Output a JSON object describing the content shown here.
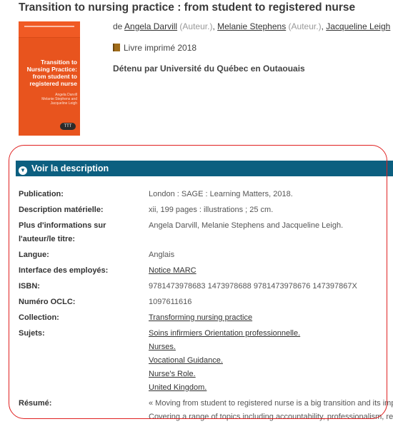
{
  "record": {
    "title": "Transition to nursing practice : from student to registered nurse",
    "by": "de",
    "authors": [
      {
        "name": "Angela Darvill",
        "role": "(Auteur.)"
      },
      {
        "name": "Melanie Stephens",
        "role": "(Auteur.)"
      },
      {
        "name": "Jacqueline Leigh",
        "role": ""
      }
    ],
    "format": "Livre imprimé 2018",
    "held_by": "Détenu par Université du Québec en Outaouais",
    "cover": {
      "title": "Transition to Nursing Practice: from student to registered nurse",
      "authors": [
        "Angela Darvill",
        "Melanie Stephens and",
        "Jacqueline Leigh"
      ],
      "badge": "TTT",
      "color": "#e8541e"
    }
  },
  "description": {
    "toggle_label": "Voir la description",
    "band_color": "#0c5f80",
    "fields": {
      "publication": {
        "label": "Publication:",
        "value": "London : SAGE : Learning Matters, 2018."
      },
      "physical": {
        "label": "Description matérielle:",
        "value": "xii, 199 pages : illustrations ; 25 cm."
      },
      "more_info": {
        "label_line1": "Plus d'informations sur",
        "label_line2": "l'auteur/le titre:",
        "value": "Angela Darvill, Melanie Stephens and Jacqueline Leigh."
      },
      "language": {
        "label": "Langue:",
        "value": "Anglais"
      },
      "staff": {
        "label": "Interface des employés:",
        "value": "Notice MARC"
      },
      "isbn": {
        "label": "ISBN:",
        "value": "9781473978683 1473978688 9781473978676 147397867X"
      },
      "oclc": {
        "label": "Numéro OCLC:",
        "value": "1097611616"
      },
      "collection": {
        "label": "Collection:",
        "value": "Transforming nursing practice"
      },
      "subjects": {
        "label": "Sujets:",
        "values": [
          "Soins infirmiers Orientation professionnelle.",
          "Nurses.",
          "Vocational Guidance.",
          "Nurse's Role.",
          "United Kingdom."
        ]
      },
      "summary": {
        "label": "Résumé:",
        "line1": "« Moving from student to registered nurse is a big transition and its impo",
        "line2": "Covering a range of topics including accountability, professionalism, re-v"
      }
    }
  }
}
